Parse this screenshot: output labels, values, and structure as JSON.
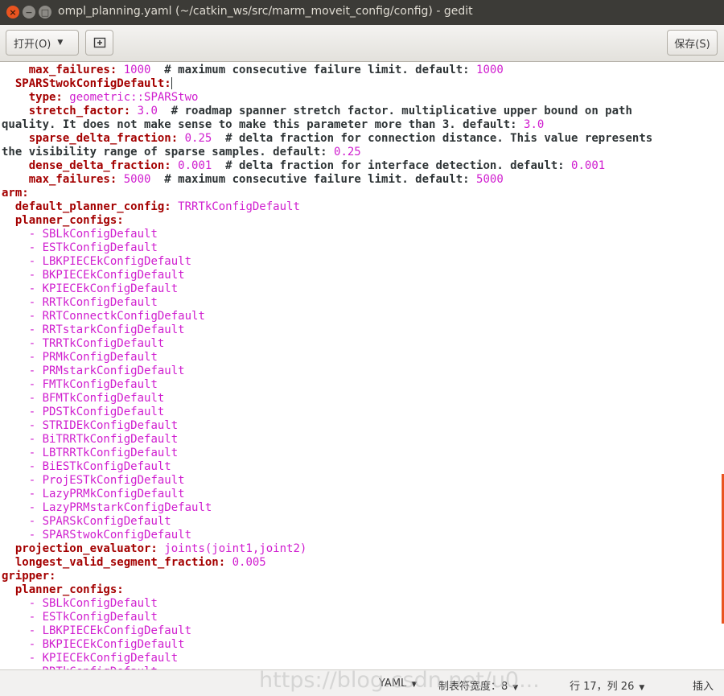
{
  "window": {
    "title": "ompl_planning.yaml (~/catkin_ws/src/marm_moveit_config/config) - gedit",
    "close_glyph": "×",
    "minimize_glyph": "−",
    "maximize_glyph": "□"
  },
  "toolbar": {
    "open_label": "打开(O)",
    "save_label": "保存(S)",
    "new_tab_icon": "new-tab-icon"
  },
  "editor": {
    "lines": [
      [
        {
          "t": "    ",
          "c": "c"
        },
        {
          "t": "max_failures:",
          "c": "k"
        },
        {
          "t": " 1000",
          "c": "s"
        },
        {
          "t": "  # maximum consecutive failure limit. default: ",
          "c": "c"
        },
        {
          "t": "1000",
          "c": "s"
        }
      ],
      [
        {
          "t": "  ",
          "c": "c"
        },
        {
          "t": "SPARStwokConfigDefault:",
          "c": "k"
        }
      ],
      [
        {
          "t": "    ",
          "c": "c"
        },
        {
          "t": "type:",
          "c": "k"
        },
        {
          "t": " geometric::SPARStwo",
          "c": "s"
        }
      ],
      [
        {
          "t": "    ",
          "c": "c"
        },
        {
          "t": "stretch_factor:",
          "c": "k"
        },
        {
          "t": " 3.0",
          "c": "s"
        },
        {
          "t": "  # roadmap spanner stretch factor. multiplicative upper bound on path",
          "c": "c"
        }
      ],
      [
        {
          "t": "quality. It does not make sense to make this parameter more than 3. default: ",
          "c": "c"
        },
        {
          "t": "3.0",
          "c": "s"
        }
      ],
      [
        {
          "t": "    ",
          "c": "c"
        },
        {
          "t": "sparse_delta_fraction:",
          "c": "k"
        },
        {
          "t": " 0.25",
          "c": "s"
        },
        {
          "t": "  # delta fraction for connection distance. This value represents",
          "c": "c"
        }
      ],
      [
        {
          "t": "the visibility range of sparse samples. default: ",
          "c": "c"
        },
        {
          "t": "0.25",
          "c": "s"
        }
      ],
      [
        {
          "t": "    ",
          "c": "c"
        },
        {
          "t": "dense_delta_fraction:",
          "c": "k"
        },
        {
          "t": " 0.001",
          "c": "s"
        },
        {
          "t": "  # delta fraction for interface detection. default: ",
          "c": "c"
        },
        {
          "t": "0.001",
          "c": "s"
        }
      ],
      [
        {
          "t": "    ",
          "c": "c"
        },
        {
          "t": "max_failures:",
          "c": "k"
        },
        {
          "t": " 5000",
          "c": "s"
        },
        {
          "t": "  # maximum consecutive failure limit. default: ",
          "c": "c"
        },
        {
          "t": "5000",
          "c": "s"
        }
      ],
      [
        {
          "t": "arm:",
          "c": "k"
        }
      ],
      [
        {
          "t": "  ",
          "c": "c"
        },
        {
          "t": "default_planner_config:",
          "c": "k"
        },
        {
          "t": " TRRTkConfigDefault",
          "c": "s"
        }
      ],
      [
        {
          "t": "  ",
          "c": "c"
        },
        {
          "t": "planner_configs:",
          "c": "k"
        }
      ],
      [
        {
          "t": "    - ",
          "c": "s"
        },
        {
          "t": "SBLkConfigDefault",
          "c": "s"
        }
      ],
      [
        {
          "t": "    - ",
          "c": "s"
        },
        {
          "t": "ESTkConfigDefault",
          "c": "s"
        }
      ],
      [
        {
          "t": "    - ",
          "c": "s"
        },
        {
          "t": "LBKPIECEkConfigDefault",
          "c": "s"
        }
      ],
      [
        {
          "t": "    - ",
          "c": "s"
        },
        {
          "t": "BKPIECEkConfigDefault",
          "c": "s"
        }
      ],
      [
        {
          "t": "    - ",
          "c": "s"
        },
        {
          "t": "KPIECEkConfigDefault",
          "c": "s"
        }
      ],
      [
        {
          "t": "    - ",
          "c": "s"
        },
        {
          "t": "RRTkConfigDefault",
          "c": "s"
        }
      ],
      [
        {
          "t": "    - ",
          "c": "s"
        },
        {
          "t": "RRTConnectkConfigDefault",
          "c": "s"
        }
      ],
      [
        {
          "t": "    - ",
          "c": "s"
        },
        {
          "t": "RRTstarkConfigDefault",
          "c": "s"
        }
      ],
      [
        {
          "t": "    - ",
          "c": "s"
        },
        {
          "t": "TRRTkConfigDefault",
          "c": "s"
        }
      ],
      [
        {
          "t": "    - ",
          "c": "s"
        },
        {
          "t": "PRMkConfigDefault",
          "c": "s"
        }
      ],
      [
        {
          "t": "    - ",
          "c": "s"
        },
        {
          "t": "PRMstarkConfigDefault",
          "c": "s"
        }
      ],
      [
        {
          "t": "    - ",
          "c": "s"
        },
        {
          "t": "FMTkConfigDefault",
          "c": "s"
        }
      ],
      [
        {
          "t": "    - ",
          "c": "s"
        },
        {
          "t": "BFMTkConfigDefault",
          "c": "s"
        }
      ],
      [
        {
          "t": "    - ",
          "c": "s"
        },
        {
          "t": "PDSTkConfigDefault",
          "c": "s"
        }
      ],
      [
        {
          "t": "    - ",
          "c": "s"
        },
        {
          "t": "STRIDEkConfigDefault",
          "c": "s"
        }
      ],
      [
        {
          "t": "    - ",
          "c": "s"
        },
        {
          "t": "BiTRRTkConfigDefault",
          "c": "s"
        }
      ],
      [
        {
          "t": "    - ",
          "c": "s"
        },
        {
          "t": "LBTRRTkConfigDefault",
          "c": "s"
        }
      ],
      [
        {
          "t": "    - ",
          "c": "s"
        },
        {
          "t": "BiESTkConfigDefault",
          "c": "s"
        }
      ],
      [
        {
          "t": "    - ",
          "c": "s"
        },
        {
          "t": "ProjESTkConfigDefault",
          "c": "s"
        }
      ],
      [
        {
          "t": "    - ",
          "c": "s"
        },
        {
          "t": "LazyPRMkConfigDefault",
          "c": "s"
        }
      ],
      [
        {
          "t": "    - ",
          "c": "s"
        },
        {
          "t": "LazyPRMstarkConfigDefault",
          "c": "s"
        }
      ],
      [
        {
          "t": "    - ",
          "c": "s"
        },
        {
          "t": "SPARSkConfigDefault",
          "c": "s"
        }
      ],
      [
        {
          "t": "    - ",
          "c": "s"
        },
        {
          "t": "SPARStwokConfigDefault",
          "c": "s"
        }
      ],
      [
        {
          "t": "  ",
          "c": "c"
        },
        {
          "t": "projection_evaluator:",
          "c": "k"
        },
        {
          "t": " joints(joint1,joint2)",
          "c": "s"
        }
      ],
      [
        {
          "t": "  ",
          "c": "c"
        },
        {
          "t": "longest_valid_segment_fraction:",
          "c": "k"
        },
        {
          "t": " 0.005",
          "c": "s"
        }
      ],
      [
        {
          "t": "gripper:",
          "c": "k"
        }
      ],
      [
        {
          "t": "  ",
          "c": "c"
        },
        {
          "t": "planner_configs:",
          "c": "k"
        }
      ],
      [
        {
          "t": "    - ",
          "c": "s"
        },
        {
          "t": "SBLkConfigDefault",
          "c": "s"
        }
      ],
      [
        {
          "t": "    - ",
          "c": "s"
        },
        {
          "t": "ESTkConfigDefault",
          "c": "s"
        }
      ],
      [
        {
          "t": "    - ",
          "c": "s"
        },
        {
          "t": "LBKPIECEkConfigDefault",
          "c": "s"
        }
      ],
      [
        {
          "t": "    - ",
          "c": "s"
        },
        {
          "t": "BKPIECEkConfigDefault",
          "c": "s"
        }
      ],
      [
        {
          "t": "    - ",
          "c": "s"
        },
        {
          "t": "KPIECEkConfigDefault",
          "c": "s"
        }
      ],
      [
        {
          "t": "    - ",
          "c": "s"
        },
        {
          "t": "RRTkConfigDefault",
          "c": "s"
        }
      ]
    ],
    "colors": {
      "key": "#a40000",
      "value": "#d01ecf",
      "text": "#2e3436"
    }
  },
  "statusbar": {
    "language": "YAML",
    "tab_width": "制表符宽度：8",
    "position": "行 17，列 26",
    "mode": "插入"
  },
  "watermark": "https://blog.csdn.net/u0..."
}
